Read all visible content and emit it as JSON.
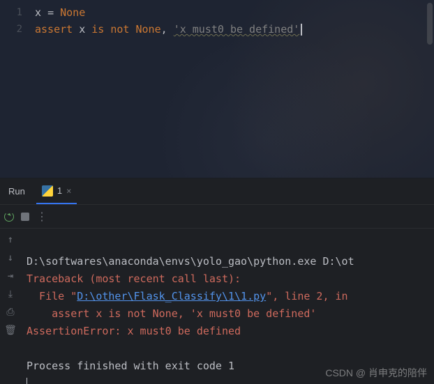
{
  "editor": {
    "lines": [
      {
        "num": "1",
        "tokens": [
          {
            "t": "x ",
            "c": "ident"
          },
          {
            "t": "= ",
            "c": "ident"
          },
          {
            "t": "None",
            "c": "kw-orange"
          }
        ]
      },
      {
        "num": "2",
        "tokens": [
          {
            "t": "assert ",
            "c": "kw-orange"
          },
          {
            "t": "x ",
            "c": "ident"
          },
          {
            "t": "is not ",
            "c": "kw-orange"
          },
          {
            "t": "None",
            "c": "kw-orange"
          },
          {
            "t": ", ",
            "c": "ident"
          },
          {
            "t": "'x must0 be defined'",
            "c": "str wavy"
          }
        ]
      }
    ]
  },
  "panel": {
    "title": "Run",
    "tab_label": "1",
    "tab_close": "×"
  },
  "console": {
    "cmd": "D:\\softwares\\anaconda\\envs\\yolo_gao\\python.exe D:\\ot",
    "traceback": "Traceback (most recent call last):",
    "file_prefix": "  File \"",
    "file_link": "D:\\other\\Flask_Classify\\1\\1.py",
    "file_suffix": "\", line 2, in ",
    "assert_line": "    assert x is not None, 'x must0 be defined'",
    "error": "AssertionError: x must0 be defined",
    "exit": "Process finished with exit code 1"
  },
  "watermark": "CSDN @ 肖申克的陪伴"
}
